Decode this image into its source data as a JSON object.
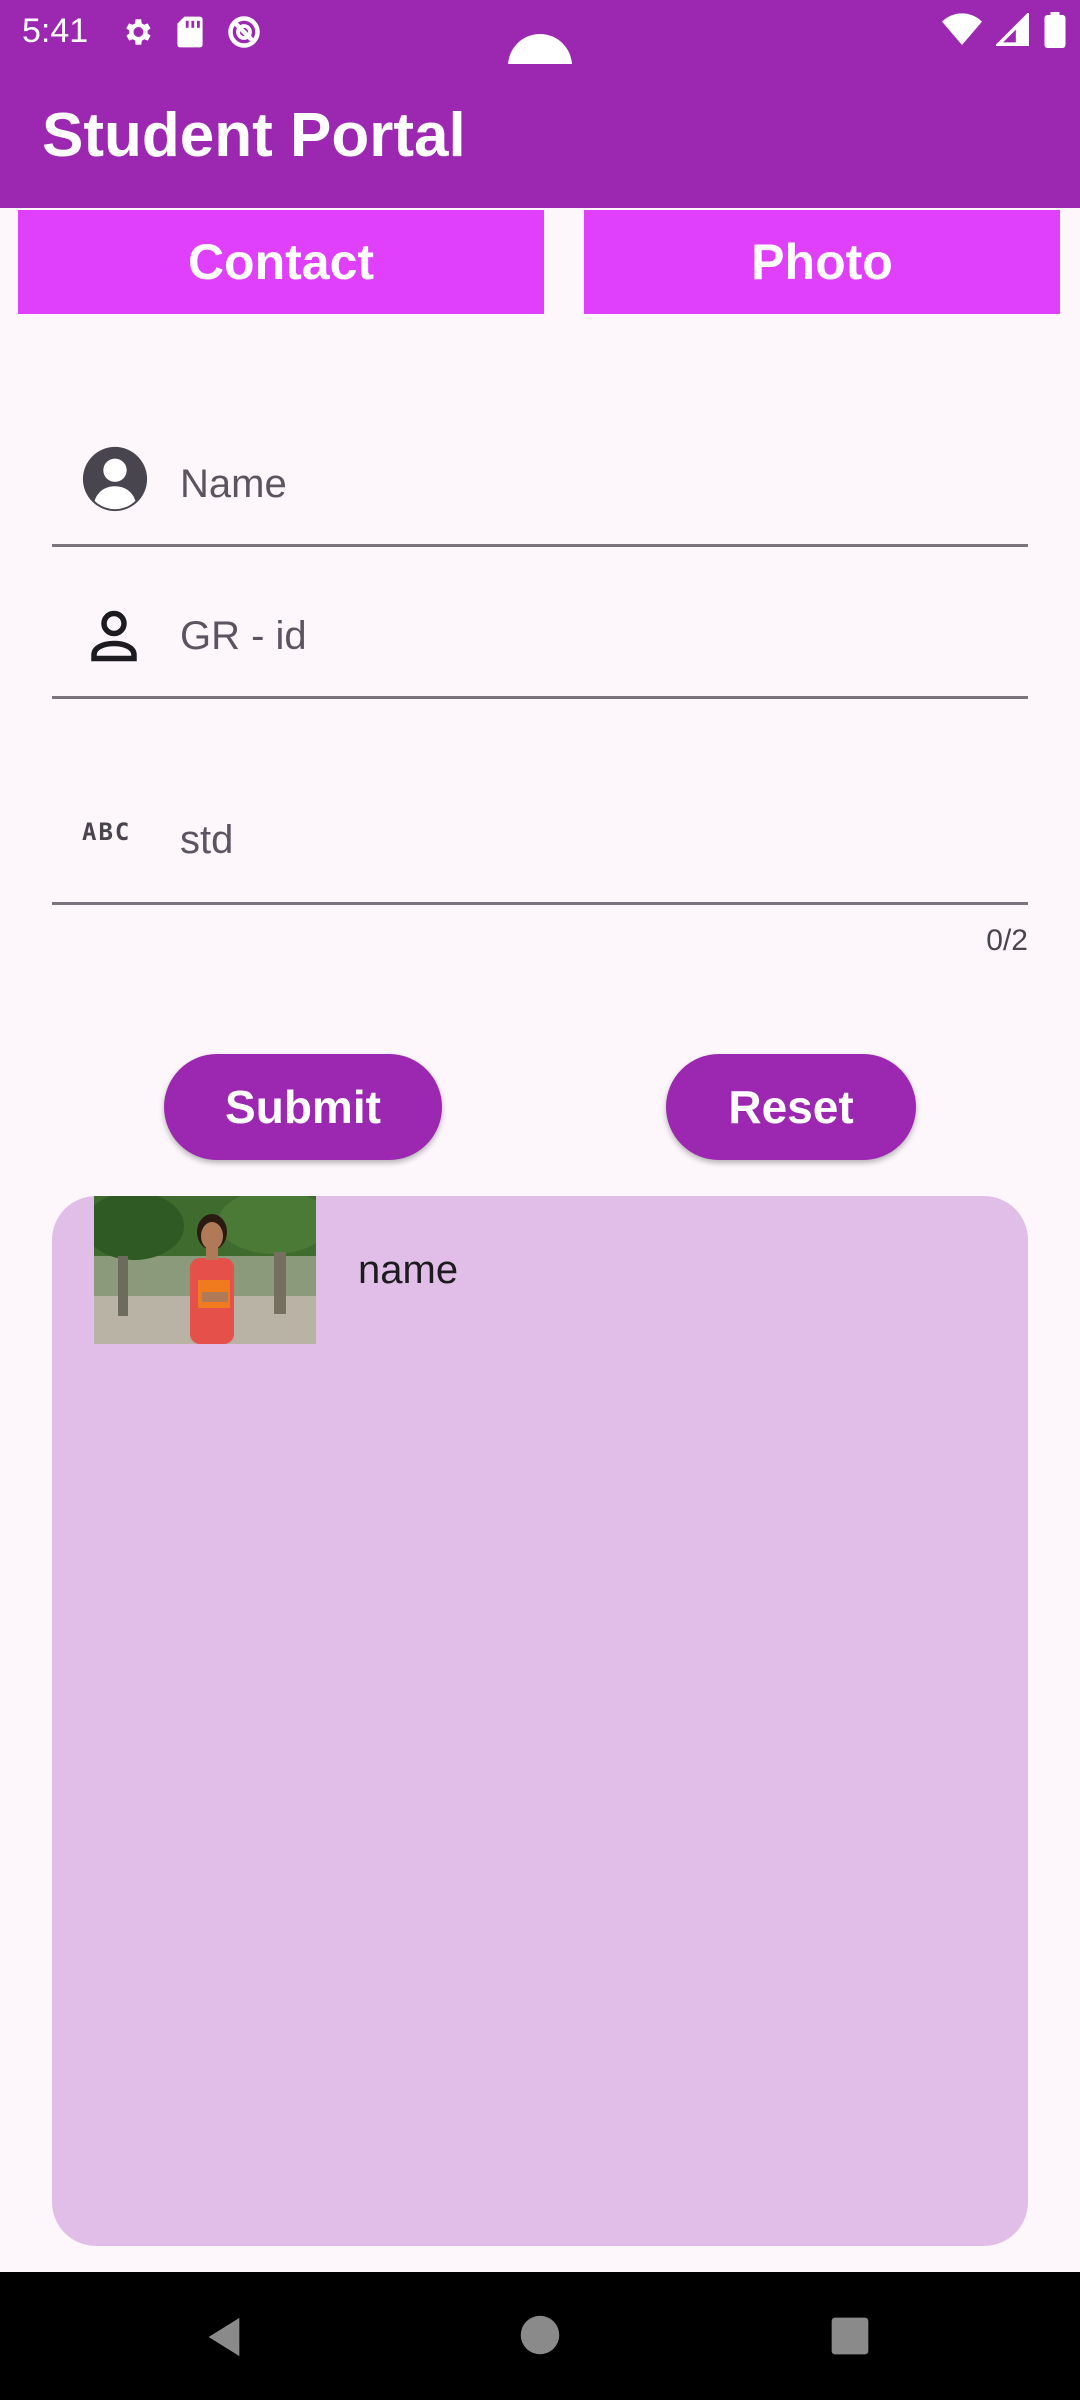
{
  "status_bar": {
    "time": "5:41",
    "icons_left": [
      "gear-icon",
      "sd-card-icon",
      "do-not-disturb-icon"
    ],
    "icons_right": [
      "wifi-icon",
      "signal-icon",
      "battery-icon"
    ]
  },
  "app_bar": {
    "title": "Student Portal",
    "color": "#9c27b0"
  },
  "tabs": [
    {
      "label": "Contact"
    },
    {
      "label": "Photo"
    }
  ],
  "form": {
    "name_field": {
      "placeholder": "Name",
      "icon": "account-circle-icon"
    },
    "grid_field": {
      "placeholder": "GR - id",
      "icon": "person-outline-icon"
    },
    "std_field": {
      "placeholder": "std",
      "icon": "abc-icon",
      "counter": "0/2"
    }
  },
  "buttons": {
    "submit": "Submit",
    "reset": "Reset"
  },
  "list": {
    "items": [
      {
        "name": "name",
        "photo": "student-photo"
      }
    ]
  },
  "colors": {
    "primary": "#9c27b0",
    "tab": "#e040fb",
    "card": "#e1bee7",
    "background": "#fdf7fc"
  }
}
